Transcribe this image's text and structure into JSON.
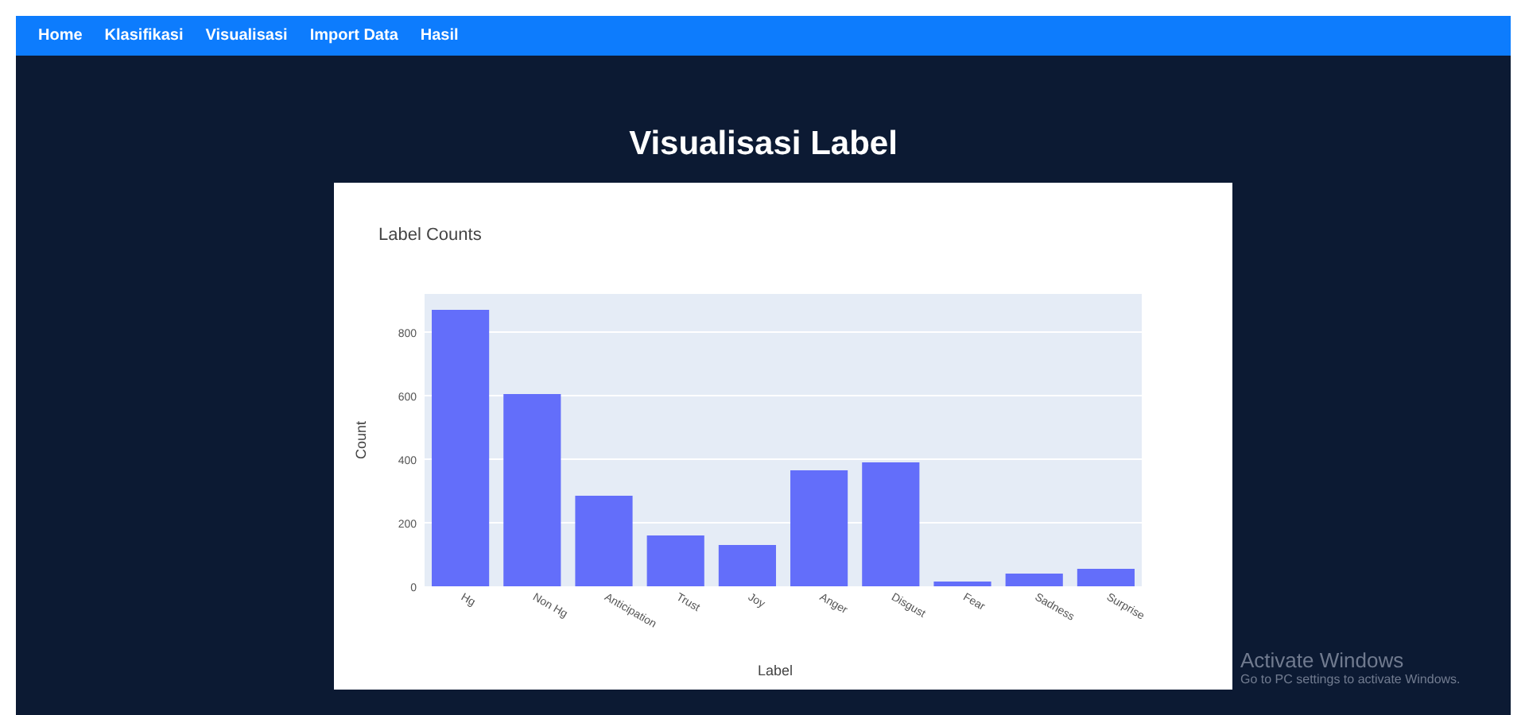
{
  "nav": {
    "items": [
      {
        "label": "Home"
      },
      {
        "label": "Klasifikasi"
      },
      {
        "label": "Visualisasi"
      },
      {
        "label": "Import Data"
      },
      {
        "label": "Hasil"
      }
    ]
  },
  "heading": "Visualisasi Label",
  "chart": {
    "chart_data": {
      "type": "bar",
      "title": "Label Counts",
      "xlabel": "Label",
      "ylabel": "Count",
      "categories": [
        "Hg",
        "Non Hg",
        "Anticipation",
        "Trust",
        "Joy",
        "Anger",
        "Disgust",
        "Fear",
        "Sadness",
        "Surprise"
      ],
      "series": [
        {
          "color": "#636efa",
          "values": [
            870,
            605,
            285,
            160,
            130,
            365,
            390,
            15,
            40,
            55
          ]
        }
      ],
      "ylim": [
        0,
        920
      ],
      "grid": true,
      "yticks": [
        0,
        200,
        400,
        600,
        800
      ]
    }
  },
  "os_notice": {
    "title": "Activate Windows",
    "text": "Go to PC settings to activate Windows."
  }
}
